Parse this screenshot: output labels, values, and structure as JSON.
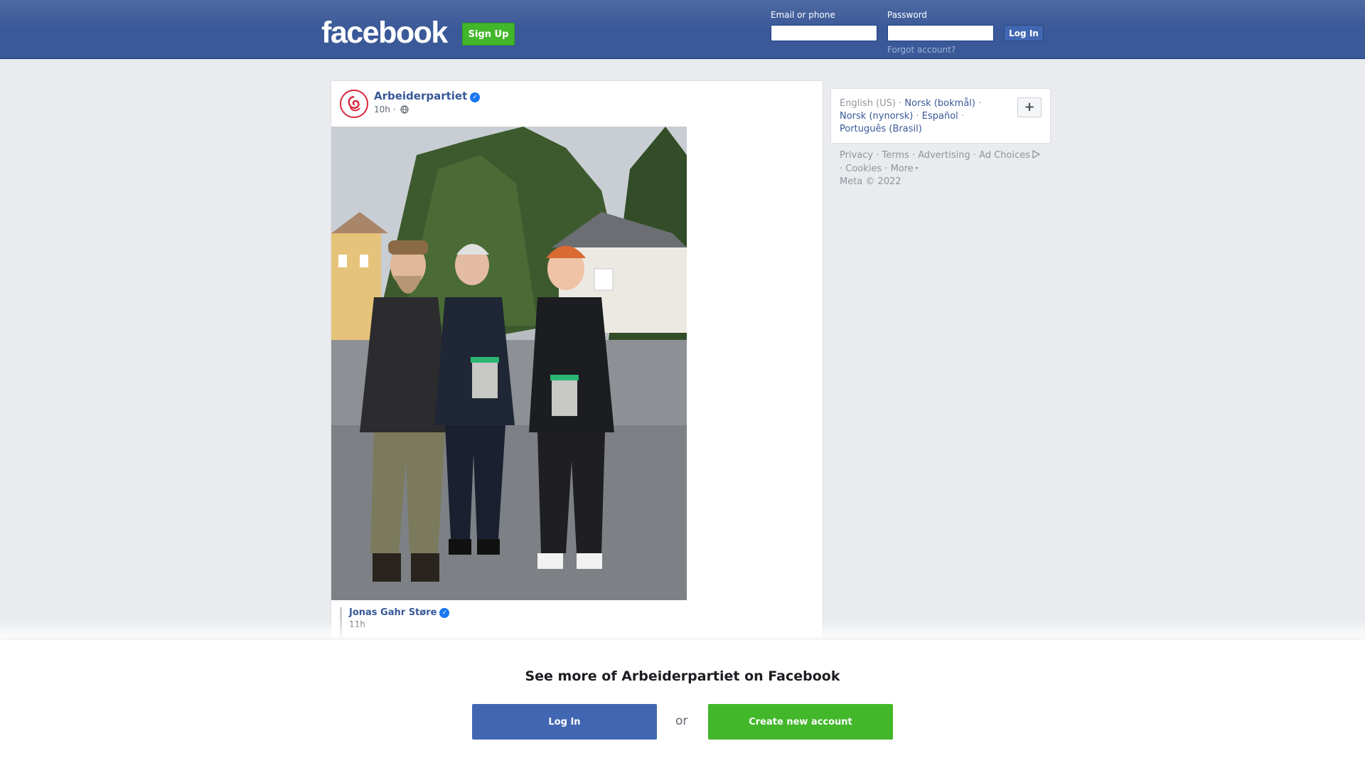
{
  "header": {
    "logo_text": "facebook",
    "signup_label": "Sign Up",
    "email_label": "Email or phone",
    "password_label": "Password",
    "login_label": "Log In",
    "forgot_label": "Forgot account?"
  },
  "post": {
    "page_name": "Arbeiderpartiet",
    "time": "10h ·",
    "photo_alt": "Three men standing on a residential street holding collection buckets",
    "shared": {
      "author": "Jonas Gahr Støre",
      "time": "11h"
    }
  },
  "sidebar": {
    "languages": {
      "current": "English (US)",
      "links": [
        "Norsk (bokmål)",
        "Norsk (nynorsk)",
        "Español",
        "Português (Brasil)"
      ]
    },
    "add_language_symbol": "+",
    "footer": {
      "links": [
        "Privacy",
        "Terms",
        "Advertising",
        "Ad Choices",
        "Cookies",
        "More"
      ],
      "copyright": "Meta © 2022"
    }
  },
  "overlay": {
    "title": "See more of Arbeiderpartiet on Facebook",
    "login_label": "Log In",
    "or_label": "or",
    "create_label": "Create new account"
  },
  "colors": {
    "brand_blue": "#3b5998",
    "link_blue": "#385898",
    "green": "#42b72a",
    "verified": "#1877f2"
  }
}
